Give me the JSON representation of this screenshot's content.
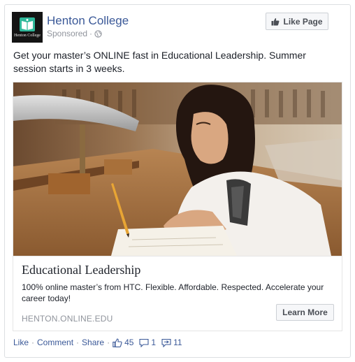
{
  "post": {
    "page_name": "Henton College",
    "logo_text": "Henton College",
    "sponsored": "Sponsored",
    "sponsored_sep": "·",
    "like_page_label": "Like Page",
    "text": "Get your master’s ONLINE fast in Educational Leadership. Summer session starts in 3 weeks."
  },
  "link": {
    "title": "Educational Leadership",
    "description": "100% online master’s from HTC. Flexible. Affordable. Respected. Accelerate your career today!",
    "domain": "HENTON.ONLINE.EDU",
    "cta_label": "Learn More"
  },
  "actions": {
    "like": "Like",
    "comment": "Comment",
    "share": "Share",
    "separator": "·",
    "likes_count": "45",
    "comments_count": "1",
    "shares_count": "11"
  },
  "colors": {
    "link_blue": "#3b5998",
    "meta_grey": "#90949c",
    "logo_green": "#2fb89a"
  }
}
